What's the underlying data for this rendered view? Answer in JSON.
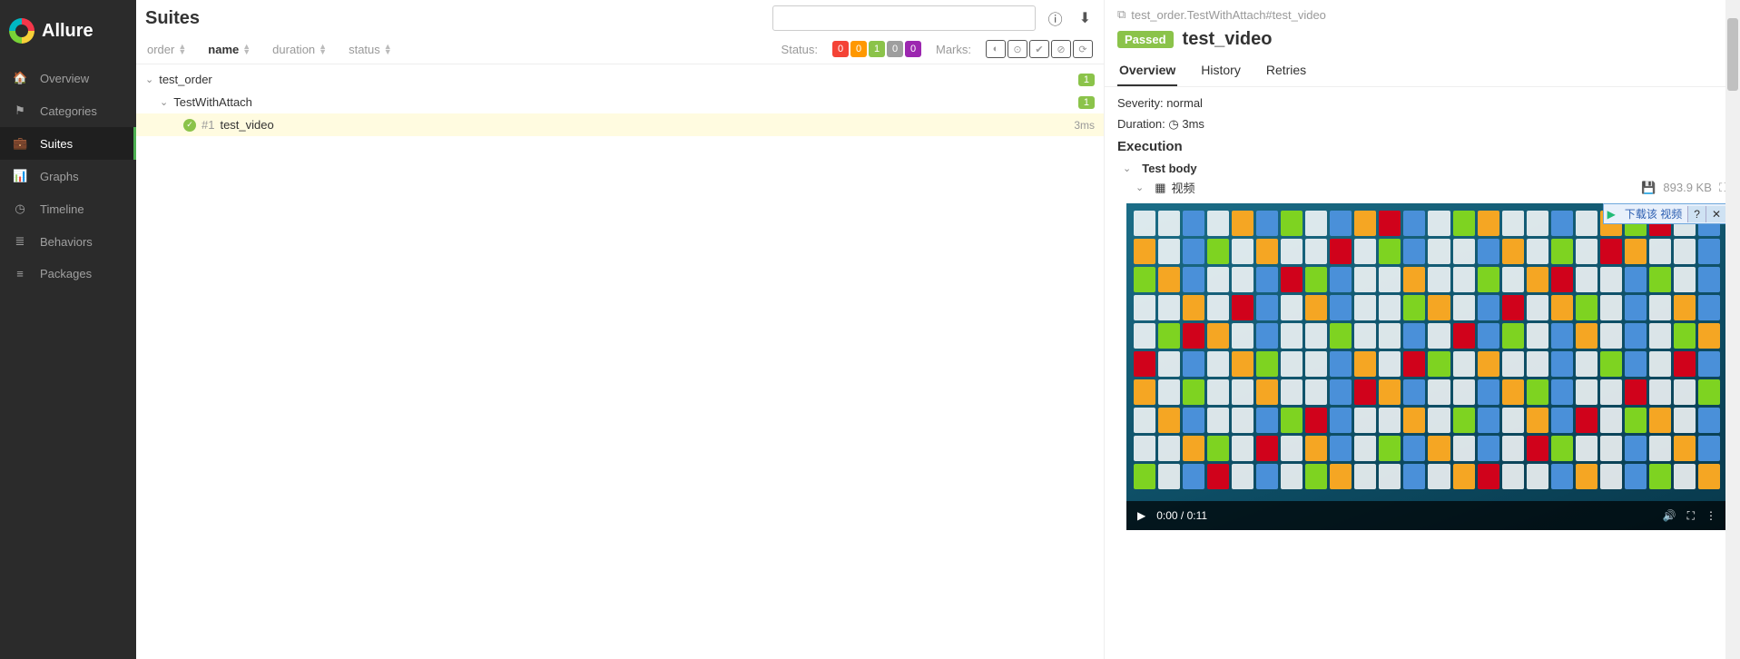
{
  "brand": "Allure",
  "nav": [
    {
      "label": "Overview",
      "icon": "home"
    },
    {
      "label": "Categories",
      "icon": "flag"
    },
    {
      "label": "Suites",
      "icon": "briefcase",
      "active": true
    },
    {
      "label": "Graphs",
      "icon": "chart"
    },
    {
      "label": "Timeline",
      "icon": "clock"
    },
    {
      "label": "Behaviors",
      "icon": "list"
    },
    {
      "label": "Packages",
      "icon": "layers"
    }
  ],
  "mid": {
    "title": "Suites",
    "search_placeholder": "",
    "columns": [
      "order",
      "name",
      "duration",
      "status"
    ],
    "active_sort": "name",
    "status_label": "Status:",
    "status_counts": [
      {
        "color": "#f44336",
        "value": "0"
      },
      {
        "color": "#ff9800",
        "value": "0"
      },
      {
        "color": "#8bc34a",
        "value": "1"
      },
      {
        "color": "#9e9e9e",
        "value": "0"
      },
      {
        "color": "#9c27b0",
        "value": "0"
      }
    ],
    "marks_label": "Marks:",
    "tree": [
      {
        "level": 0,
        "label": "test_order",
        "badge": "1",
        "expanded": true
      },
      {
        "level": 1,
        "label": "TestWithAttach",
        "badge": "1",
        "expanded": true
      },
      {
        "level": 2,
        "num": "#1",
        "label": "test_video",
        "duration": "3ms",
        "status": "passed",
        "selected": true
      }
    ]
  },
  "detail": {
    "breadcrumb": "test_order.TestWithAttach#test_video",
    "status": "Passed",
    "status_color": "#8bc34a",
    "name": "test_video",
    "tabs": [
      "Overview",
      "History",
      "Retries"
    ],
    "active_tab": "Overview",
    "severity_label": "Severity:",
    "severity": "normal",
    "duration_label": "Duration:",
    "duration": "3ms",
    "execution_label": "Execution",
    "test_body_label": "Test body",
    "attachment_label": "视频",
    "attachment_size": "893.9 KB",
    "download_banner": "下载该 视频",
    "video_time": "0:00 / 0:11"
  }
}
